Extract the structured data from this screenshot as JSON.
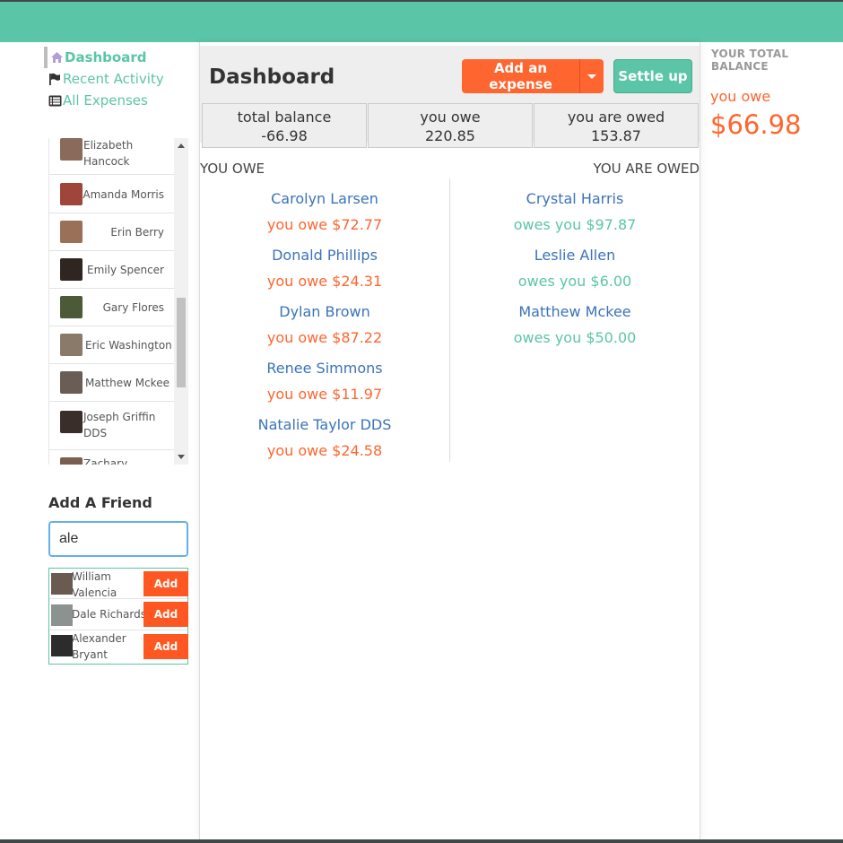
{
  "nav": [
    {
      "label": "Dashboard",
      "icon": "home-icon"
    },
    {
      "label": "Recent Activity",
      "icon": "flag-icon"
    },
    {
      "label": "All Expenses",
      "icon": "list-icon"
    }
  ],
  "friends": [
    {
      "name": "Elizabeth Hancock",
      "line1": "Elizabeth",
      "line2": "Hancock"
    },
    {
      "name": "Amanda Morris"
    },
    {
      "name": "Erin Berry"
    },
    {
      "name": "Emily Spencer"
    },
    {
      "name": "Gary Flores"
    },
    {
      "name": "Eric Washington"
    },
    {
      "name": "Matthew Mckee"
    },
    {
      "name": "Joseph Griffin DDS",
      "line1": "Joseph Griffin",
      "line2": "DDS"
    },
    {
      "name": "Zachary",
      "line1": "Zachary"
    }
  ],
  "add_friend": {
    "title": "Add A Friend",
    "query": "ale",
    "results": [
      {
        "line1": "William",
        "line2": "Valencia",
        "button": "Add"
      },
      {
        "line1": "Dale Richards",
        "button": "Add"
      },
      {
        "line1": "Alexander",
        "line2": "Bryant",
        "button": "Add"
      }
    ]
  },
  "main": {
    "title": "Dashboard",
    "add_expense_label": "Add an expense",
    "settle_label": "Settle up",
    "stats": [
      {
        "title": "total balance",
        "value": "-66.98"
      },
      {
        "title": "you owe",
        "value": "220.85"
      },
      {
        "title": "you are owed",
        "value": "153.87"
      }
    ],
    "you_owe_heading": "YOU OWE",
    "you_are_owed_heading": "YOU ARE OWED",
    "you_owe": [
      {
        "name": "Carolyn Larsen",
        "amount": "you owe $72.77"
      },
      {
        "name": "Donald Phillips",
        "amount": "you owe $24.31"
      },
      {
        "name": "Dylan Brown",
        "amount": "you owe $87.22"
      },
      {
        "name": "Renee Simmons",
        "amount": "you owe $11.97"
      },
      {
        "name": "Natalie Taylor DDS",
        "amount": "you owe $24.58"
      }
    ],
    "owed": [
      {
        "name": "Crystal Harris",
        "amount": "owes you $97.87"
      },
      {
        "name": "Leslie Allen",
        "amount": "owes you $6.00"
      },
      {
        "name": "Matthew Mckee",
        "amount": "owes you $50.00"
      }
    ]
  },
  "right": {
    "title": "YOUR TOTAL BALANCE",
    "label": "you owe",
    "amount": "$66.98"
  },
  "colors": {
    "brand_green": "#5bc5a7",
    "brand_orange": "#ff652f",
    "link_blue": "#3b73b9",
    "add_button": "#ff5722"
  }
}
